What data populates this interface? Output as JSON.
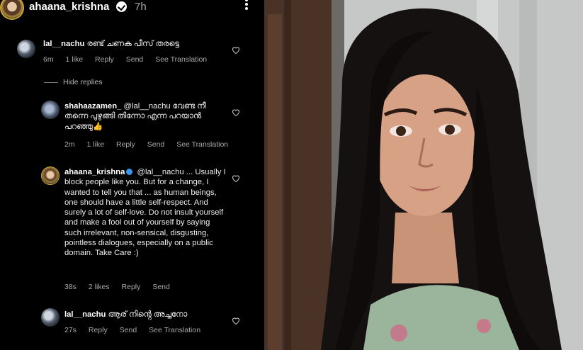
{
  "header": {
    "username": "ahaana_krishna",
    "time": "7h"
  },
  "replies_toggle": "Hide replies",
  "comments": [
    {
      "username": "lal__nachu",
      "text": "രണ്ട് ചണക പീസ് തരട്ടെ",
      "time": "6m",
      "likes": "1 like",
      "reply": "Reply",
      "send": "Send",
      "translation": "See Translation"
    },
    {
      "username": "shahaazamen_",
      "text": "@lal__nachu വേണ്ട നീ തന്നെ പുഴുങ്ങി തിന്നോ എന്ന പറയാൻ പറഞ്ഞു👍",
      "time": "2m",
      "likes": "1 like",
      "reply": "Reply",
      "send": "Send",
      "translation": "See Translation"
    },
    {
      "username": "ahaana_krishna",
      "text": "@lal__nachu ... Usually I block people like you. But for a change, I wanted to tell you that ... as human beings, one should have a little self-respect. And surely a lot of self-love. Do not insult yourself and make a fool out of yourself by saying such irrelevant, non-sensical, disgusting, pointless dialogues, especially on a public domain. Take Care :)",
      "time": "38s",
      "likes": "2 likes",
      "reply": "Reply",
      "send": "Send"
    },
    {
      "username": "lal__nachu",
      "text": "ആര് നിൻ്റെ അച്ചനോ",
      "time": "27s",
      "reply": "Reply",
      "send": "Send",
      "translation": "See Translation"
    }
  ],
  "icons": {
    "header_avatar": "avatar",
    "verified": "verified-badge-icon",
    "more": "more-dots-icon",
    "like": "heart-icon"
  }
}
